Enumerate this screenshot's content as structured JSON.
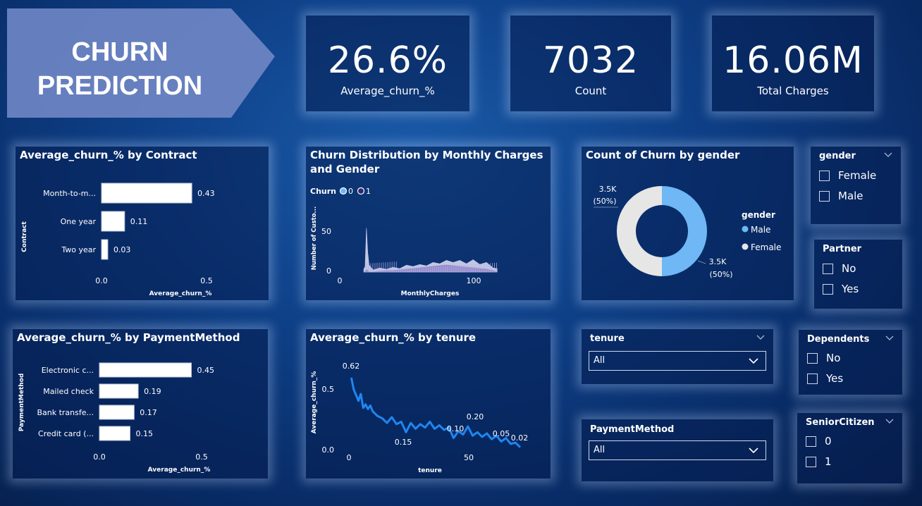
{
  "banner": {
    "title": "CHURN PREDICTION"
  },
  "kpis": [
    {
      "value": "26.6%",
      "label": "Average_churn_%"
    },
    {
      "value": "7032",
      "label": "Count"
    },
    {
      "value": "16.06M",
      "label": "Total Charges"
    }
  ],
  "charts": {
    "contract": {
      "title": "Average_churn_% by Contract",
      "ylabel": "Contract",
      "xlabel": "Average_churn_%",
      "ticks": [
        "0.0",
        "0.5"
      ],
      "categories": [
        "Month-to-m...",
        "One year",
        "Two year"
      ],
      "labels": [
        "0.43",
        "0.11",
        "0.03"
      ]
    },
    "monthly": {
      "title_line1": "Churn Distribution by Monthly Charges",
      "title_line2": "and Gender",
      "legend_title": "Churn",
      "legend_items": [
        "0",
        "1"
      ],
      "ylabel": "Number of Custo...",
      "xlabel": "MonthlyCharges",
      "yticks": [
        "50",
        "0"
      ],
      "xticks": [
        "0",
        "100"
      ]
    },
    "gender": {
      "title": "Count of Churn by gender",
      "legend_title": "gender",
      "legend_items": [
        "Male",
        "Female"
      ],
      "label_left_value": "3.5K",
      "label_left_pct": "(50%)",
      "label_right_value": "3.5K",
      "label_right_pct": "(50%)"
    },
    "payment": {
      "title": "Average_churn_% by PaymentMethod",
      "ylabel": "PaymentMethod",
      "xlabel": "Average_churn_%",
      "ticks": [
        "0.0",
        "0.5"
      ],
      "categories": [
        "Electronic c...",
        "Mailed check",
        "Bank transfe...",
        "Credit card (..."
      ],
      "labels": [
        "0.45",
        "0.19",
        "0.17",
        "0.15"
      ]
    },
    "tenure": {
      "title": "Average_churn_% by tenure",
      "ylabel": "Average_churn_%",
      "xlabel": "tenure",
      "yticks": [
        "0.5",
        "0.0"
      ],
      "xticks": [
        "0",
        "50"
      ],
      "annotations": [
        "0.62",
        "0.15",
        "0.10",
        "0.20",
        "0.05",
        "0.02"
      ]
    }
  },
  "chart_data": [
    {
      "type": "bar",
      "title": "Average_churn_% by Contract",
      "categories": [
        "Month-to-m...",
        "One year",
        "Two year"
      ],
      "values": [
        0.43,
        0.11,
        0.03
      ],
      "xlabel": "Average_churn_%",
      "ylabel": "Contract",
      "xlim": [
        0,
        0.5
      ],
      "orientation": "horizontal"
    },
    {
      "type": "bar",
      "title": "Average_churn_% by PaymentMethod",
      "categories": [
        "Electronic c...",
        "Mailed check",
        "Bank transfe...",
        "Credit card (..."
      ],
      "values": [
        0.45,
        0.19,
        0.17,
        0.15
      ],
      "xlabel": "Average_churn_%",
      "ylabel": "PaymentMethod",
      "xlim": [
        0,
        0.5
      ],
      "orientation": "horizontal"
    },
    {
      "type": "pie",
      "title": "Count of Churn by gender",
      "categories": [
        "Male",
        "Female"
      ],
      "values": [
        3500,
        3500
      ],
      "colors": [
        "#6fb7f5",
        "#e6e6e6"
      ]
    },
    {
      "type": "area",
      "title": "Churn Distribution by Monthly Charges and Gender",
      "xlabel": "MonthlyCharges",
      "ylabel": "Number of Custo...",
      "xlim": [
        0,
        120
      ],
      "ylim": [
        0,
        80
      ],
      "x": [
        18,
        19,
        20,
        21,
        22,
        25,
        30,
        35,
        40,
        45,
        50,
        55,
        60,
        65,
        70,
        75,
        80,
        85,
        90,
        95,
        100,
        105,
        110,
        115,
        118
      ],
      "series": [
        {
          "name": "0",
          "values": [
            2,
            10,
            62,
            30,
            8,
            5,
            4,
            6,
            5,
            7,
            8,
            10,
            9,
            11,
            12,
            14,
            15,
            16,
            15,
            14,
            16,
            13,
            12,
            8,
            3
          ]
        },
        {
          "name": "1",
          "values": [
            0,
            2,
            5,
            3,
            1,
            1,
            2,
            3,
            3,
            4,
            5,
            6,
            7,
            8,
            9,
            10,
            11,
            10,
            9,
            8,
            7,
            6,
            5,
            3,
            1
          ]
        }
      ]
    },
    {
      "type": "line",
      "title": "Average_churn_% by tenure",
      "xlabel": "tenure",
      "ylabel": "Average_churn_%",
      "xlim": [
        0,
        72
      ],
      "ylim": [
        0,
        0.65
      ],
      "x": [
        1,
        2,
        3,
        4,
        5,
        6,
        7,
        8,
        9,
        10,
        12,
        14,
        16,
        18,
        20,
        22,
        24,
        26,
        28,
        30,
        32,
        34,
        36,
        38,
        40,
        42,
        44,
        46,
        48,
        50,
        52,
        54,
        56,
        58,
        60,
        62,
        64,
        66,
        68,
        70,
        72
      ],
      "values": [
        0.62,
        0.52,
        0.47,
        0.42,
        0.48,
        0.36,
        0.39,
        0.35,
        0.38,
        0.33,
        0.29,
        0.27,
        0.23,
        0.28,
        0.22,
        0.24,
        0.15,
        0.23,
        0.18,
        0.22,
        0.19,
        0.24,
        0.18,
        0.21,
        0.17,
        0.19,
        0.1,
        0.16,
        0.13,
        0.2,
        0.12,
        0.15,
        0.11,
        0.14,
        0.09,
        0.12,
        0.07,
        0.1,
        0.05,
        0.06,
        0.02
      ]
    }
  ],
  "slicers": {
    "gender": {
      "title": "gender",
      "options": [
        "Female",
        "Male"
      ]
    },
    "partner": {
      "title": "Partner",
      "options": [
        "No",
        "Yes"
      ]
    },
    "dependents": {
      "title": "Dependents",
      "options": [
        "No",
        "Yes"
      ]
    },
    "senior": {
      "title": "SeniorCitizen",
      "options": [
        "0",
        "1"
      ]
    },
    "tenure": {
      "title": "tenure",
      "value": "All"
    },
    "payment": {
      "title": "PaymentMethod",
      "value": "All"
    }
  }
}
